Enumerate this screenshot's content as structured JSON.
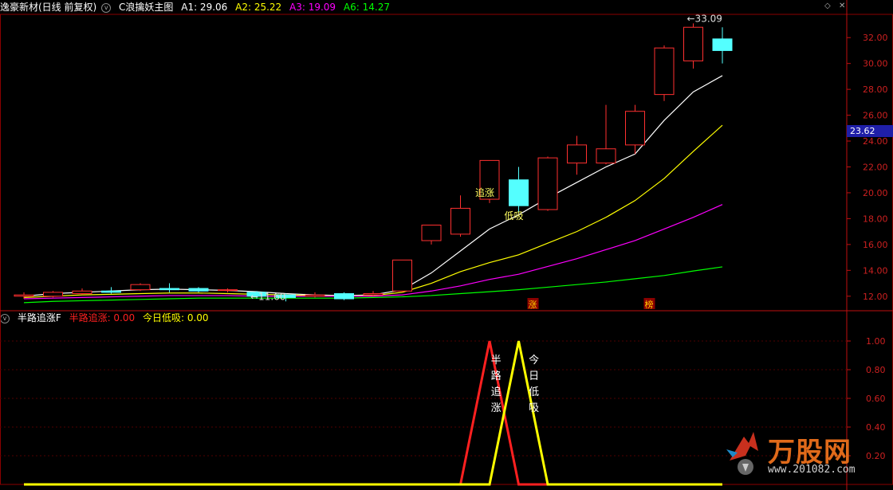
{
  "header": {
    "stock_name": "逸豪新材(日线 前复权)",
    "indicator_icon": "collapse-icon",
    "indicator_name": "C浪擒妖主图",
    "ma": [
      {
        "label": "A1: 29.06",
        "color": "#ffffff"
      },
      {
        "label": "A2: 25.22",
        "color": "#ffff00"
      },
      {
        "label": "A3: 19.09",
        "color": "#ff00ff"
      },
      {
        "label": "A6: 14.27",
        "color": "#00ff00"
      }
    ]
  },
  "sub_header": {
    "indicator_name": "半路追涨F",
    "items": [
      {
        "label": "半路追涨: 0.00",
        "color": "#ff2020"
      },
      {
        "label": "今日低吸: 0.00",
        "color": "#ffff00"
      }
    ]
  },
  "current_price_label": "23.62",
  "logo": {
    "text": "万股网",
    "url": "www.201082.com"
  },
  "chart_data": [
    {
      "type": "candlestick",
      "name": "main",
      "ylim": [
        11,
        33.8
      ],
      "y_ticks": [
        "12.00",
        "14.00",
        "16.00",
        "18.00",
        "20.00",
        "22.00",
        "24.00",
        "26.00",
        "28.00",
        "30.00",
        "32.00"
      ],
      "y_tick_values": [
        12,
        14,
        16,
        18,
        20,
        22,
        24,
        26,
        28,
        30,
        32
      ],
      "x_count": 24,
      "candles": [
        {
          "x": 1,
          "o": 12.0,
          "c": 12.1,
          "h": 12.3,
          "l": 11.8
        },
        {
          "x": 2,
          "o": 12.0,
          "c": 12.3,
          "h": 12.4,
          "l": 11.9
        },
        {
          "x": 3,
          "o": 12.2,
          "c": 12.4,
          "h": 12.6,
          "l": 12.1
        },
        {
          "x": 4,
          "o": 12.4,
          "c": 12.3,
          "h": 12.7,
          "l": 12.2
        },
        {
          "x": 5,
          "o": 12.5,
          "c": 12.9,
          "h": 13.0,
          "l": 12.4
        },
        {
          "x": 6,
          "o": 12.6,
          "c": 12.5,
          "h": 13.0,
          "l": 12.3
        },
        {
          "x": 7,
          "o": 12.6,
          "c": 12.4,
          "h": 12.7,
          "l": 12.3
        },
        {
          "x": 8,
          "o": 12.5,
          "c": 12.5,
          "h": 12.6,
          "l": 12.3
        },
        {
          "x": 9,
          "o": 12.3,
          "c": 12.0,
          "h": 12.4,
          "l": 11.8
        },
        {
          "x": 10,
          "o": 12.1,
          "c": 11.9,
          "h": 12.2,
          "l": 11.6
        },
        {
          "x": 11,
          "o": 12.0,
          "c": 12.1,
          "h": 12.3,
          "l": 11.9
        },
        {
          "x": 12,
          "o": 12.2,
          "c": 11.8,
          "h": 12.3,
          "l": 11.7
        },
        {
          "x": 13,
          "o": 12.1,
          "c": 12.2,
          "h": 12.4,
          "l": 12.0
        },
        {
          "x": 14,
          "o": 12.4,
          "c": 14.8,
          "h": 14.8,
          "l": 12.3
        },
        {
          "x": 15,
          "o": 16.3,
          "c": 17.5,
          "h": 17.5,
          "l": 16.0
        },
        {
          "x": 16,
          "o": 16.8,
          "c": 18.8,
          "h": 19.8,
          "l": 16.6
        },
        {
          "x": 17,
          "o": 19.5,
          "c": 22.5,
          "h": 22.5,
          "l": 19.2
        },
        {
          "x": 18,
          "o": 21.0,
          "c": 19.0,
          "h": 22.0,
          "l": 18.5
        },
        {
          "x": 19,
          "o": 18.7,
          "c": 22.7,
          "h": 22.8,
          "l": 18.6
        },
        {
          "x": 20,
          "o": 22.3,
          "c": 23.7,
          "h": 24.4,
          "l": 21.4
        },
        {
          "x": 21,
          "o": 22.3,
          "c": 23.4,
          "h": 26.8,
          "l": 22.2
        },
        {
          "x": 22,
          "o": 23.7,
          "c": 26.3,
          "h": 26.8,
          "l": 23.0
        },
        {
          "x": 23,
          "o": 27.6,
          "c": 31.2,
          "h": 31.4,
          "l": 27.1
        },
        {
          "x": 24,
          "o": 30.2,
          "c": 32.8,
          "h": 33.1,
          "l": 29.6
        },
        {
          "x": 25,
          "o": 31.9,
          "c": 31.0,
          "h": 32.8,
          "l": 30.0
        }
      ],
      "series": [
        {
          "name": "A1",
          "color": "#ffffff",
          "values": [
            12.0,
            12.2,
            12.3,
            12.4,
            12.5,
            12.55,
            12.5,
            12.45,
            12.35,
            12.2,
            12.1,
            12.05,
            12.1,
            12.5,
            13.8,
            15.5,
            17.2,
            18.3,
            19.6,
            20.8,
            22.0,
            23.0,
            25.6,
            27.8,
            29.06
          ]
        },
        {
          "name": "A2",
          "color": "#ffff00",
          "values": [
            11.9,
            12.0,
            12.1,
            12.15,
            12.2,
            12.25,
            12.25,
            12.2,
            12.15,
            12.1,
            12.05,
            12.0,
            12.05,
            12.3,
            13.0,
            13.9,
            14.6,
            15.2,
            16.1,
            17.0,
            18.1,
            19.4,
            21.1,
            23.2,
            25.22
          ]
        },
        {
          "name": "A3",
          "color": "#ff00ff",
          "values": [
            11.8,
            11.85,
            11.9,
            11.95,
            12.0,
            12.05,
            12.05,
            12.05,
            12.0,
            12.0,
            12.0,
            12.0,
            12.0,
            12.1,
            12.4,
            12.8,
            13.3,
            13.7,
            14.3,
            14.9,
            15.6,
            16.3,
            17.2,
            18.1,
            19.09
          ]
        },
        {
          "name": "A6",
          "color": "#00ff00",
          "values": [
            11.5,
            11.6,
            11.65,
            11.7,
            11.75,
            11.8,
            11.85,
            11.85,
            11.85,
            11.85,
            11.85,
            11.85,
            11.9,
            11.95,
            12.05,
            12.2,
            12.35,
            12.5,
            12.7,
            12.9,
            13.1,
            13.35,
            13.6,
            13.95,
            14.27
          ]
        }
      ],
      "annotations": [
        {
          "text": "33.09",
          "x": 24,
          "y": 33.09
        },
        {
          "text": "11.60",
          "x": 9,
          "y": 11.6
        },
        {
          "text": "追涨",
          "x": 17,
          "y": 20.0
        },
        {
          "text": "低吸",
          "x": 18,
          "y": 18.2
        }
      ],
      "bottom_tags": [
        {
          "text": "涨",
          "x": 18
        },
        {
          "text": "榜",
          "x": 22
        }
      ]
    },
    {
      "type": "line",
      "name": "sub",
      "ylim": [
        0,
        1.1
      ],
      "y_ticks": [
        "1.00",
        "0.80",
        "0.60",
        "0.40",
        "0.20"
      ],
      "y_tick_values": [
        1.0,
        0.8,
        0.6,
        0.4,
        0.2
      ],
      "series": [
        {
          "name": "半路追涨",
          "color": "#ff2020",
          "points": [
            [
              1,
              0
            ],
            [
              16,
              0
            ],
            [
              17,
              1
            ],
            [
              18,
              0
            ],
            [
              19,
              0
            ],
            [
              25,
              0
            ]
          ]
        },
        {
          "name": "今日低吸",
          "color": "#ffff00",
          "points": [
            [
              1,
              0
            ],
            [
              17,
              0
            ],
            [
              18,
              1
            ],
            [
              19,
              0
            ],
            [
              25,
              0
            ]
          ]
        }
      ],
      "annotations": [
        {
          "text": "半路追涨",
          "x": 17.1,
          "y": 0.8,
          "color": "#ffffff"
        },
        {
          "text": "今日低吸",
          "x": 18.4,
          "y": 0.8,
          "color": "#ffffff"
        }
      ]
    }
  ]
}
